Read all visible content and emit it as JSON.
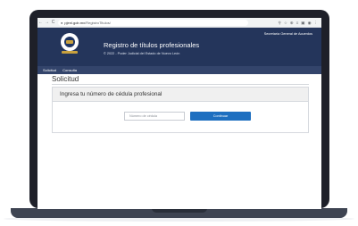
{
  "browser": {
    "url_host": "pjenl.gob.mx",
    "url_path": "/RegistroTitulos/",
    "nav": {
      "back": "←",
      "forward": "→",
      "reload": "C"
    },
    "toolbar_icons": [
      "⚲",
      "☆",
      "⊕",
      "≡",
      "▣",
      "◉",
      "⋮"
    ]
  },
  "header": {
    "title": "Registro de títulos profesionales",
    "subtitle": "© 2022 - Poder Judicial del Estado de Nuevo León",
    "secretaria": "Secretaría General de Acuerdos"
  },
  "nav": {
    "items": [
      {
        "label": "Solicitud"
      },
      {
        "label": "Consulta"
      }
    ]
  },
  "main": {
    "heading": "Solicitud",
    "card_title": "Ingresa tu número de cédula profesional",
    "input_placeholder": "Número de cédula",
    "input_value": "",
    "button_label": "Continuar"
  },
  "colors": {
    "header": "#24355b",
    "navbar": "#33446b",
    "button": "#1e6fc0",
    "bezel": "#1e2029"
  }
}
